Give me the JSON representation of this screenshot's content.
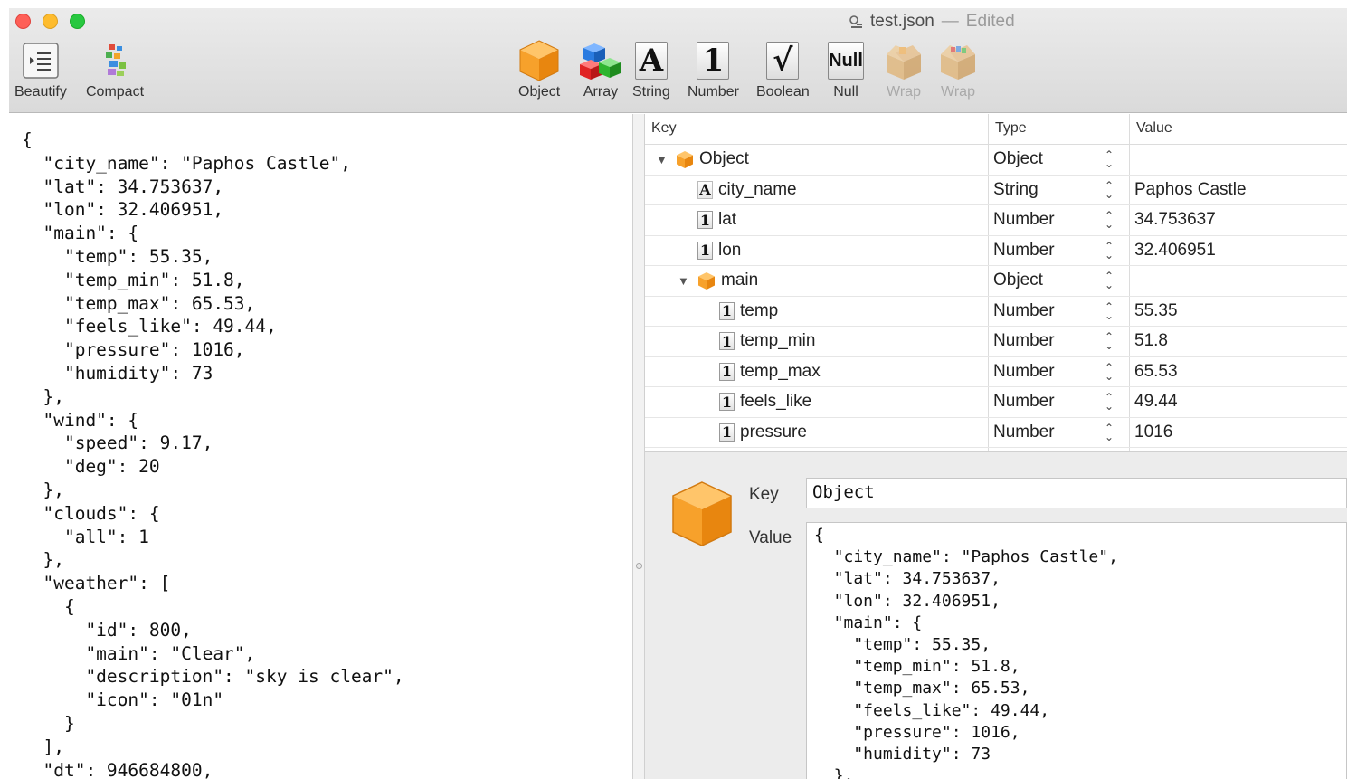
{
  "window": {
    "title": "test.json",
    "title_separator": "—",
    "edited_label": "Edited"
  },
  "toolbar": {
    "beautify_label": "Beautify",
    "compact_label": "Compact",
    "object_label": "Object",
    "array_label": "Array",
    "string_label": "String",
    "number_label": "Number",
    "boolean_label": "Boolean",
    "null_label": "Null",
    "wrap1_label": "Wrap",
    "wrap2_label": "Wrap",
    "string_glyph": "A",
    "number_glyph": "1",
    "boolean_glyph": "√",
    "null_glyph": "Null"
  },
  "editor": {
    "lines": [
      "{",
      "  \"city_name\": \"Paphos Castle\",",
      "  \"lat\": 34.753637,",
      "  \"lon\": 32.406951,",
      "  \"main\": {",
      "    \"temp\": 55.35,",
      "    \"temp_min\": 51.8,",
      "    \"temp_max\": 65.53,",
      "    \"feels_like\": 49.44,",
      "    \"pressure\": 1016,",
      "    \"humidity\": 73",
      "  },",
      "  \"wind\": {",
      "    \"speed\": 9.17,",
      "    \"deg\": 20",
      "  },",
      "  \"clouds\": {",
      "    \"all\": 1",
      "  },",
      "  \"weather\": [",
      "    {",
      "      \"id\": 800,",
      "      \"main\": \"Clear\",",
      "      \"description\": \"sky is clear\",",
      "      \"icon\": \"01n\"",
      "    }",
      "  ],",
      "  \"dt\": 946684800,"
    ]
  },
  "outline": {
    "headers": {
      "key": "Key",
      "type": "Type",
      "value": "Value"
    },
    "rows": [
      {
        "key": "Object",
        "type": "Object",
        "value": ""
      },
      {
        "key": "city_name",
        "type": "String",
        "value": "Paphos Castle"
      },
      {
        "key": "lat",
        "type": "Number",
        "value": "34.753637"
      },
      {
        "key": "lon",
        "type": "Number",
        "value": "32.406951"
      },
      {
        "key": "main",
        "type": "Object",
        "value": ""
      },
      {
        "key": "temp",
        "type": "Number",
        "value": "55.35"
      },
      {
        "key": "temp_min",
        "type": "Number",
        "value": "51.8"
      },
      {
        "key": "temp_max",
        "type": "Number",
        "value": "65.53"
      },
      {
        "key": "feels_like",
        "type": "Number",
        "value": "49.44"
      },
      {
        "key": "pressure",
        "type": "Number",
        "value": "1016"
      }
    ]
  },
  "detail": {
    "key_label": "Key",
    "value_label": "Value",
    "key_value": "Object",
    "value_lines": [
      "{",
      "  \"city_name\": \"Paphos Castle\",",
      "  \"lat\": 34.753637,",
      "  \"lon\": 32.406951,",
      "  \"main\": {",
      "    \"temp\": 55.35,",
      "    \"temp_min\": 51.8,",
      "    \"temp_max\": 65.53,",
      "    \"feels_like\": 49.44,",
      "    \"pressure\": 1016,",
      "    \"humidity\": 73",
      "  },"
    ]
  },
  "colors": {
    "close": "#fe5f57",
    "minimize": "#febc2e",
    "maximize": "#28c840",
    "object_cube": "#f7a12b"
  },
  "icons": {
    "beautify": "indent-lines-icon",
    "compact": "compact-blocks-icon",
    "object": "orange-cube-icon",
    "array": "colored-cubes-icon",
    "wrap": "open-box-icon",
    "document": "json-document-icon"
  }
}
